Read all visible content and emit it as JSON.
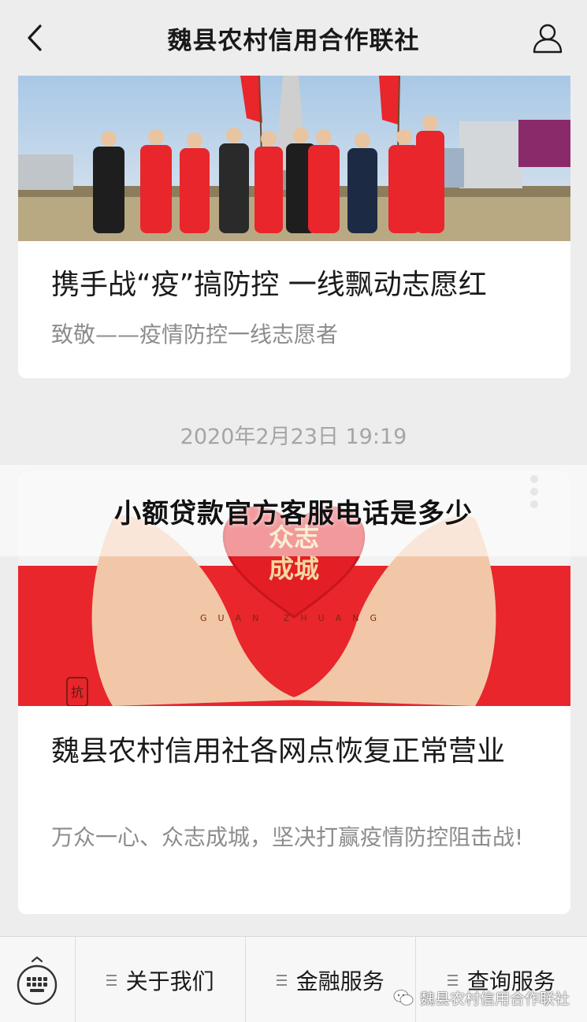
{
  "navbar": {
    "title": "魏县农村信用合作联社",
    "back_icon": "chevron-left-icon",
    "user_icon": "user-icon"
  },
  "articles": [
    {
      "title": "携手战“疫”搞防控  一线飘动志愿红",
      "description": "致敬——疫情防控一线志愿者"
    },
    {
      "title": "魏县农村信用社各网点恢复正常营业",
      "description": "万众一心、众志成城，坚决打赢疫情防控阻击战!",
      "image_text": {
        "line1": "众志",
        "line2": "成城",
        "caption": "GUAN ZHUANG",
        "side": "抗"
      }
    }
  ],
  "timestamp": "2020年2月23日 19:19",
  "overlay": {
    "text": "小额贷款官方客服电话是多少"
  },
  "bottom_menu": {
    "keyboard_icon": "keyboard-icon",
    "items": [
      {
        "label": "关于我们"
      },
      {
        "label": "金融服务"
      },
      {
        "label": "查询服务"
      }
    ]
  },
  "watermark": {
    "text": "魏县农村信用合作联社"
  },
  "colors": {
    "background": "#ededed",
    "card": "#ffffff",
    "desc_text": "#8c8c8c",
    "accent_red": "#e8262b"
  }
}
